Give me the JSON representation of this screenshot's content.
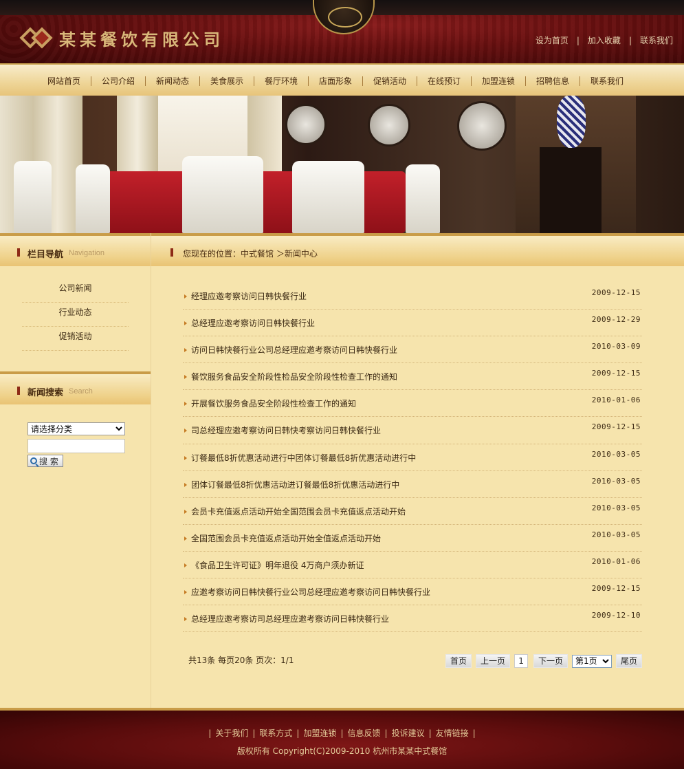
{
  "header": {
    "site_title": "某某餐饮有限公司",
    "toplinks": [
      "设为首页",
      "加入收藏",
      "联系我们"
    ]
  },
  "nav": [
    "网站首页",
    "公司介绍",
    "新闻动态",
    "美食展示",
    "餐厅环境",
    "店面形象",
    "促销活动",
    "在线预订",
    "加盟连锁",
    "招聘信息",
    "联系我们"
  ],
  "sidebar": {
    "nav_title": "栏目导航",
    "nav_title_en": "Navigation",
    "items": [
      "公司新闻",
      "行业动态",
      "促销活动"
    ],
    "search_title": "新闻搜索",
    "search_title_en": "Search",
    "select_value": "请选择分类",
    "search_button": "搜 索"
  },
  "breadcrumb": "您现在的位置：中式餐馆 ＞新闻中心",
  "news": [
    {
      "title": "经理应邀考察访问日韩快餐行业",
      "date": "2009-12-15"
    },
    {
      "title": "总经理应邀考察访问日韩快餐行业",
      "date": "2009-12-29"
    },
    {
      "title": "访问日韩快餐行业公司总经理应邀考察访问日韩快餐行业",
      "date": "2010-03-09"
    },
    {
      "title": "餐饮服务食品安全阶段性检品安全阶段性检查工作的通知",
      "date": "2009-12-15"
    },
    {
      "title": "开展餐饮服务食品安全阶段性检查工作的通知",
      "date": "2010-01-06"
    },
    {
      "title": "司总经理应邀考察访问日韩快考察访问日韩快餐行业",
      "date": "2009-12-15"
    },
    {
      "title": "订餐最低8折优惠活动进行中团体订餐最低8折优惠活动进行中",
      "date": "2010-03-05"
    },
    {
      "title": "团体订餐最低8折优惠活动进订餐最低8折优惠活动进行中",
      "date": "2010-03-05"
    },
    {
      "title": "会员卡充值返点活动开始全国范围会员卡充值返点活动开始",
      "date": "2010-03-05"
    },
    {
      "title": "全国范围会员卡充值返点活动开始全值返点活动开始",
      "date": "2010-03-05"
    },
    {
      "title": "《食品卫生许可证》明年退役  4万商户须办新证",
      "date": "2010-01-06"
    },
    {
      "title": "应邀考察访问日韩快餐行业公司总经理应邀考察访问日韩快餐行业",
      "date": "2009-12-15"
    },
    {
      "title": "总经理应邀考察访司总经理应邀考察访问日韩快餐行业",
      "date": "2009-12-10"
    }
  ],
  "pager": {
    "info": "共13条  每页20条  页次：1/1",
    "first": "首页",
    "prev": "上一页",
    "current": "1",
    "next": "下一页",
    "select_value": "第1页",
    "last": "尾页"
  },
  "footer": {
    "links": [
      "关于我们",
      "联系方式",
      "加盟连锁",
      "信息反馈",
      "投诉建议",
      "友情链接"
    ],
    "copyright": "版权所有  Copyright(C)2009-2010 杭州市某某中式餐馆"
  },
  "colors": {
    "header_red": "#6a1010",
    "gold": "#c99c48",
    "page_bg": "#f6e4ad"
  }
}
